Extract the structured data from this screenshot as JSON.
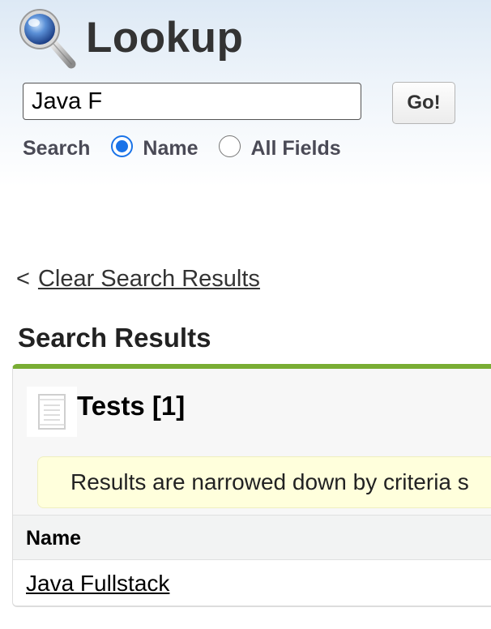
{
  "header": {
    "title": "Lookup",
    "icon": "magnifier-icon"
  },
  "search": {
    "value": "Java F",
    "go_label": "Go!",
    "scope_label": "Search",
    "options": [
      {
        "label": "Name",
        "selected": true
      },
      {
        "label": "All Fields",
        "selected": false
      }
    ]
  },
  "clear": {
    "prefix": "<",
    "link_label": "Clear Search Results"
  },
  "results": {
    "section_title": "Search Results",
    "panel_title": "Tests [1]",
    "panel_icon": "document-icon",
    "notice": "Results are narrowed down by criteria s",
    "columns": [
      "Name"
    ],
    "rows": [
      {
        "name": "Java Fullstack"
      }
    ]
  },
  "colors": {
    "accent_bar": "#79ad34",
    "radio_selected": "#1a73e8",
    "notice_bg": "#ffffdc"
  }
}
